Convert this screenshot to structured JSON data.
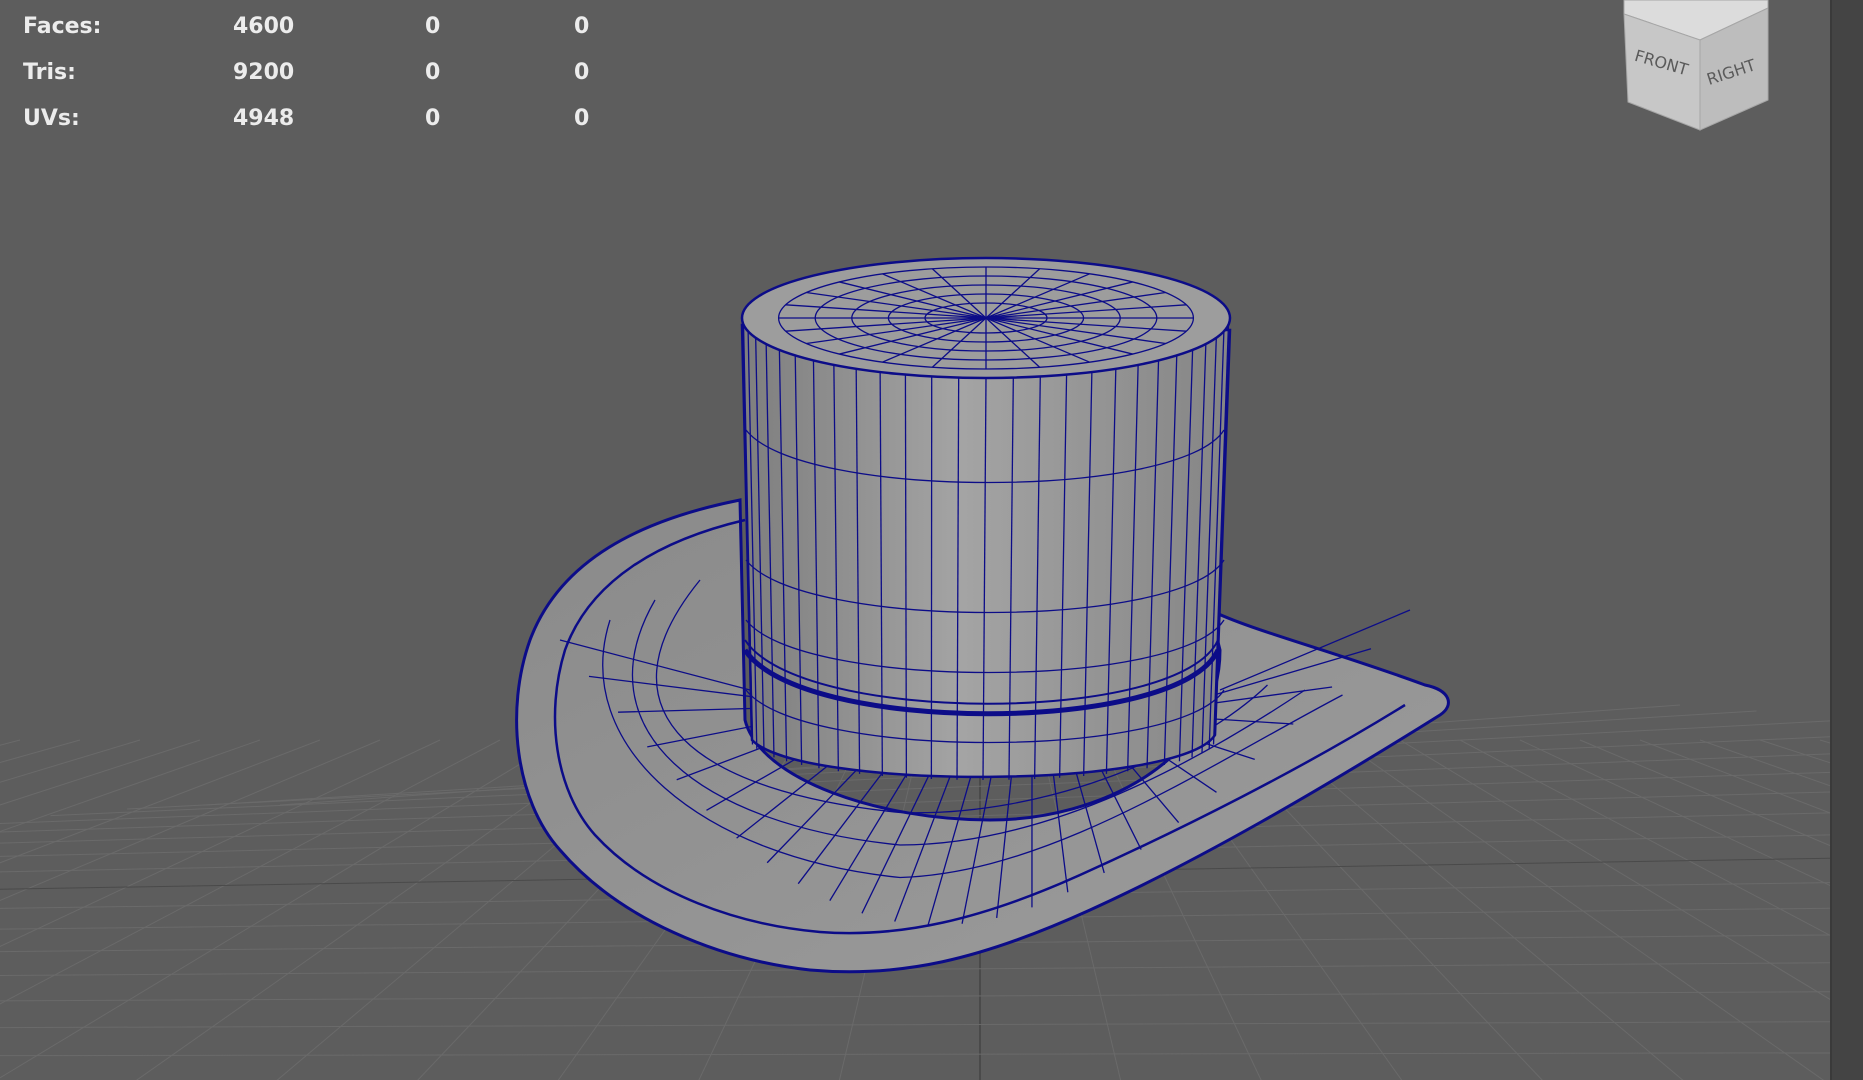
{
  "hud": {
    "rows": [
      {
        "label": "Faces:",
        "values": [
          "4600",
          "0",
          "0"
        ]
      },
      {
        "label": "Tris:",
        "values": [
          "9200",
          "0",
          "0"
        ]
      },
      {
        "label": "UVs:",
        "values": [
          "4948",
          "0",
          "0"
        ]
      }
    ]
  },
  "viewcube": {
    "front_label": "FRONT",
    "right_label": "RIGHT"
  },
  "colors": {
    "background": "#5d5d5d",
    "grid": "#6a6a6a",
    "grid_axis": "#4a4a4a",
    "wireframe": "#0c0c88",
    "mesh_fill": "#8f8f8f"
  },
  "icons": {
    "viewcube": "view-cube-icon"
  }
}
